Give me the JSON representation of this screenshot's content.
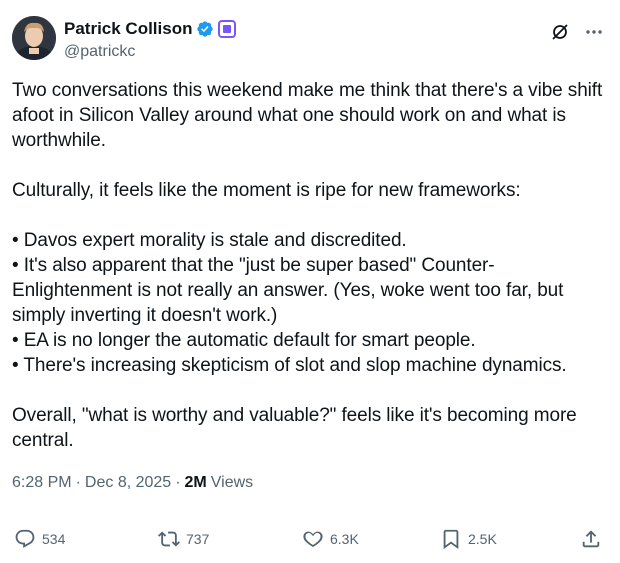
{
  "author": {
    "display_name": "Patrick Collison",
    "handle": "@patrickc",
    "verified_icon": "verified-badge-icon",
    "affiliate_icon": "affiliate-badge-icon",
    "accent_color": "#1d9bf0",
    "affiliate_color": "#7856ff"
  },
  "header_actions": {
    "grok_icon": "grok-icon",
    "more_icon": "more-icon"
  },
  "tweet": {
    "paragraph_1": "Two conversations this weekend make me think that there's a vibe shift afoot in Silicon Valley around what one should work on and what is worthwhile.",
    "paragraph_2": "Culturally, it feels like the moment is ripe for new frameworks:",
    "bullets": [
      "• Davos expert morality is stale and discredited.",
      "• It's also apparent that the \"just be super based\" Counter-Enlightenment is not really an answer. (Yes, woke went too far, but simply inverting it doesn't work.)",
      "• EA is no longer the automatic default for smart people.",
      "• There's increasing skepticism of slot and slop machine dynamics."
    ],
    "paragraph_3": "Overall, \"what is worthy and valuable?\" feels like it's becoming more central."
  },
  "meta": {
    "time": "6:28 PM",
    "separator": "·",
    "date": "Dec 8, 2025",
    "views_count": "2M",
    "views_label": "Views"
  },
  "actions": {
    "replies": "534",
    "reposts": "737",
    "likes": "6.3K",
    "bookmarks": "2.5K"
  }
}
